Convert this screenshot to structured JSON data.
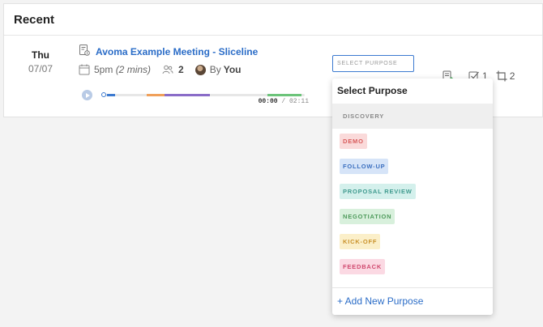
{
  "recent": {
    "title": "Recent"
  },
  "meeting": {
    "day": "Thu",
    "date": "07/07",
    "title": "Avoma Example Meeting - Sliceline",
    "time": "5pm",
    "duration": "(2 mins)",
    "attendees": "2",
    "by_label": "By",
    "organizer": "You",
    "player": {
      "current_time": "00:00",
      "total_time": "/ 02:11",
      "progress": 0
    }
  },
  "purpose_select": {
    "placeholder": "SELECT PURPOSE"
  },
  "actions": {
    "tasks_count": "1",
    "clips_count": "2"
  },
  "dropdown": {
    "header": "Select Purpose",
    "items": [
      {
        "label": "DISCOVERY",
        "fg": "#8a8a8a",
        "bg": "transparent"
      },
      {
        "label": "DEMO",
        "fg": "#d85a5a",
        "bg": "#fadada"
      },
      {
        "label": "FOLLOW-UP",
        "fg": "#3b6fbf",
        "bg": "#d6e4f8"
      },
      {
        "label": "PROPOSAL REVIEW",
        "fg": "#3f9a8e",
        "bg": "#d4f0ec"
      },
      {
        "label": "NEGOTIATION",
        "fg": "#4e9a5b",
        "bg": "#d8f0dc"
      },
      {
        "label": "KICK-OFF",
        "fg": "#c9912a",
        "bg": "#fbefc9"
      },
      {
        "label": "FEEDBACK",
        "fg": "#d0496f",
        "bg": "#fbd9e3"
      },
      {
        "label": "",
        "fg": "#3b6fbf",
        "bg": "#d6e4f8"
      }
    ],
    "add_label": "+ Add New Purpose"
  },
  "colors": {
    "accent": "#2a6cc7",
    "timeline_segments": [
      "#3c7ad0",
      "#f0a05a",
      "#8a6cc8",
      "#6cc47a"
    ]
  }
}
